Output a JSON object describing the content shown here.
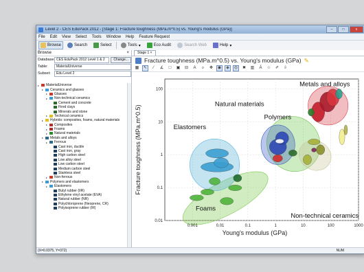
{
  "window": {
    "title": "Level 2 - CES EduPack 2012 - [Stage 1: Fracture toughness (MPa.m^0.5) vs. Young's modulus (GPa)]",
    "controls": [
      "–",
      "□",
      "x"
    ]
  },
  "menu": [
    "File",
    "Edit",
    "View",
    "Select",
    "Tools",
    "Window",
    "Help",
    "Feature Request"
  ],
  "toolbar": {
    "browse": "Browse",
    "search": "Search",
    "select": "Select",
    "tools": "Tools",
    "eco": "Eco Audit",
    "searchweb": "Search Web",
    "help": "Help"
  },
  "left": {
    "header": "Browse",
    "database_label": "Database:",
    "database_value": "CES EduPack 2012 Level 1 & 2",
    "change_button": "Change...",
    "table_label": "Table:",
    "table_value": "MaterialUniverse",
    "subset_label": "Subset:",
    "subset_value": "Edu Level 2",
    "tree": [
      {
        "label": "MaterialUniverse",
        "level": 0,
        "color": "#c8392e"
      },
      {
        "label": "Ceramics and glasses",
        "level": 1,
        "color": "#3b9bd6"
      },
      {
        "label": "Glasses",
        "level": 2,
        "color": "#c8392e"
      },
      {
        "label": "Non-technical ceramics",
        "level": 2,
        "color": "#3b9bd6"
      },
      {
        "label": "Cement and concrete",
        "level": 3,
        "color": "#2c6b2c"
      },
      {
        "label": "Fired clays",
        "level": 3,
        "color": "#2c6b2c"
      },
      {
        "label": "Minerals and stone",
        "level": 3,
        "color": "#2c6b2c"
      },
      {
        "label": "Technical ceramics",
        "level": 2,
        "color": "#e0c020"
      },
      {
        "label": "Hybrids: composites, foams, natural materials",
        "level": 1,
        "color": "#e0c020"
      },
      {
        "label": "Composites",
        "level": 2,
        "color": "#b03030"
      },
      {
        "label": "Foams",
        "level": 2,
        "color": "#b03030"
      },
      {
        "label": "Natural materials",
        "level": 2,
        "color": "#2c8c2c"
      },
      {
        "label": "Metals and alloys",
        "level": 1,
        "color": "#2c6b8c"
      },
      {
        "label": "Ferrous",
        "level": 2,
        "color": "#2c6b8c"
      },
      {
        "label": "Cast iron, ductile",
        "level": 3,
        "color": "#1f3f5f"
      },
      {
        "label": "Cast iron, gray",
        "level": 3,
        "color": "#1f3f5f"
      },
      {
        "label": "High carbon steel",
        "level": 3,
        "color": "#1f3f5f"
      },
      {
        "label": "Low alloy steel",
        "level": 3,
        "color": "#1f3f5f"
      },
      {
        "label": "Low carbon steel",
        "level": 3,
        "color": "#1f3f5f"
      },
      {
        "label": "Medium carbon steel",
        "level": 3,
        "color": "#1f3f5f"
      },
      {
        "label": "Stainless steel",
        "level": 3,
        "color": "#1f3f5f"
      },
      {
        "label": "Non-ferrous",
        "level": 2,
        "color": "#c8392e"
      },
      {
        "label": "Polymers and elastomers",
        "level": 1,
        "color": "#3b9bd6"
      },
      {
        "label": "Elastomers",
        "level": 2,
        "color": "#3b9bd6"
      },
      {
        "label": "Butyl rubber (IIR)",
        "level": 3,
        "color": "#1f3f5f"
      },
      {
        "label": "Ethylene vinyl acetate (EVA)",
        "level": 3,
        "color": "#1f3f5f"
      },
      {
        "label": "Natural rubber (NR)",
        "level": 3,
        "color": "#1f3f5f"
      },
      {
        "label": "Polychloroprene (Neoprene, CR)",
        "level": 3,
        "color": "#1f3f5f"
      },
      {
        "label": "Polyisoprene rubber (IR)",
        "level": 3,
        "color": "#1f3f5f"
      }
    ]
  },
  "tab": {
    "label": "Stage 1"
  },
  "chart": {
    "title": "Fracture toughness (MPa.m^0.5) vs. Young's modulus (GPa)"
  },
  "chart_data": {
    "type": "scatter",
    "xlabel": "Young's modulus (GPa)",
    "ylabel": "Fracture toughness (MPa.m^0.5)",
    "xscale": "log",
    "yscale": "log",
    "xlim": [
      0.0001,
      1000
    ],
    "ylim": [
      0.01,
      200
    ],
    "x_ticks": [
      "0.001",
      "0.01",
      "0.1",
      "1",
      "10",
      "100",
      "1000"
    ],
    "y_ticks": [
      "100",
      "10",
      "1",
      "0.1",
      "0.01"
    ],
    "grid": true,
    "annotations": [
      "Metals and alloys",
      "Natural materials",
      "Polymers",
      "Elastomers",
      "Foams",
      "Non-technical ceramics"
    ],
    "families": [
      {
        "name": "Foams",
        "color": "#7cc84a",
        "x": [
          0.0003,
          0.8
        ],
        "y": [
          0.015,
          0.15
        ]
      },
      {
        "name": "Natural materials",
        "color": "#6fc84e",
        "x": [
          0.5,
          40
        ],
        "y": [
          0.3,
          15
        ]
      },
      {
        "name": "Elastomers",
        "color": "#56b2d8",
        "x": [
          0.0008,
          0.05
        ],
        "y": [
          0.08,
          3
        ]
      },
      {
        "name": "Polymers",
        "color": "#3a5fc4",
        "x": [
          0.3,
          5
        ],
        "y": [
          0.5,
          8
        ]
      },
      {
        "name": "Metals and alloys",
        "color": "#d8424a",
        "x": [
          15,
          420
        ],
        "y": [
          8,
          120
        ]
      },
      {
        "name": "Non-technical ceramics",
        "color": "#c9c79a",
        "x": [
          8,
          90
        ],
        "y": [
          0.3,
          3
        ]
      }
    ]
  },
  "status": {
    "coords": "(X=0.0375, Y=372)",
    "mode": "NUM"
  }
}
